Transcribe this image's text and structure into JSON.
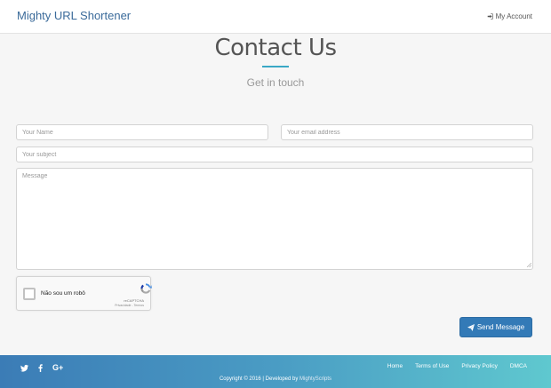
{
  "navbar": {
    "brand": "Mighty URL Shortener",
    "account": "My Account",
    "account_icon": "sign-in-icon"
  },
  "hero": {
    "title": "Contact Us",
    "subtitle": "Get in touch"
  },
  "form": {
    "name_placeholder": "Your Name",
    "email_placeholder": "Your email address",
    "subject_placeholder": "Your subject",
    "message_placeholder": "Message",
    "submit_label": "Send Message",
    "submit_icon": "paper-plane-icon"
  },
  "captcha": {
    "label": "Não sou um robô",
    "brand": "reCAPTCHA",
    "links": "Privacidade - Termos"
  },
  "footer": {
    "social": [
      {
        "name": "twitter-icon"
      },
      {
        "name": "facebook-icon"
      },
      {
        "name": "google-plus-icon",
        "label": "G+"
      }
    ],
    "links": [
      "Home",
      "Terms of Use",
      "Privacy Policy",
      "DMCA"
    ],
    "copyright": "Copyright © 2016 | Developed by",
    "developer": "MightyScripts"
  },
  "colors": {
    "brand": "#3a6a9a",
    "accent": "#3aa8c6",
    "button": "#337ab7",
    "footer_start": "#3b7cb6",
    "footer_end": "#5fc8cf"
  }
}
